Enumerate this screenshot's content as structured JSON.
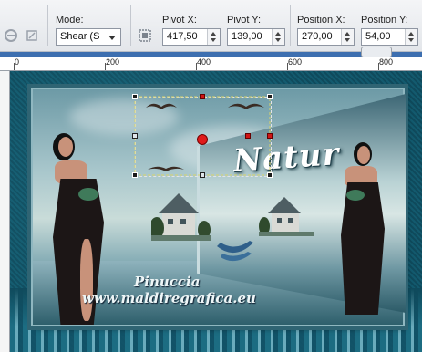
{
  "toolbar": {
    "mode": {
      "label": "Mode:",
      "value": "Shear (S"
    },
    "pivot_x": {
      "label": "Pivot X:",
      "value": "417,50"
    },
    "pivot_y": {
      "label": "Pivot Y:",
      "value": "139,00"
    },
    "position_x": {
      "label": "Position X:",
      "value": "270,00"
    },
    "position_y": {
      "label": "Position Y:",
      "value": "54,00"
    }
  },
  "ruler": {
    "marks": [
      "0",
      "200",
      "400",
      "600",
      "800"
    ]
  },
  "artwork": {
    "title": "Natur",
    "watermark_line1": "Pinuccia",
    "watermark_line2": "www.maldiregrafica.eu"
  },
  "colors": {
    "ruler_accent": "#3d6fb0",
    "canvas_bg": "#0f4a5c",
    "handle_red": "#d01515"
  }
}
